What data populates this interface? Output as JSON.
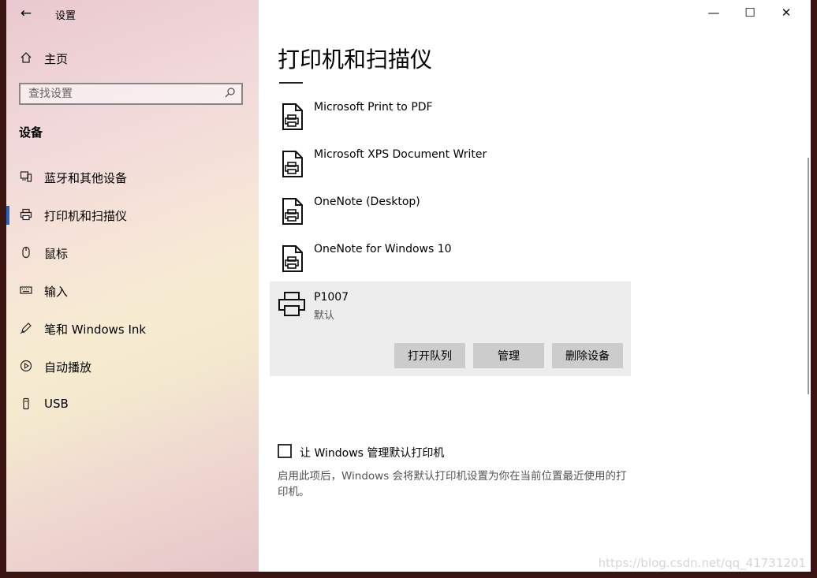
{
  "app": {
    "title": "设置"
  },
  "window_controls": {
    "minimize": "—",
    "maximize": "☐",
    "close": "✕"
  },
  "sidebar": {
    "home_label": "主页",
    "search_placeholder": "查找设置",
    "section_title": "设备",
    "items": [
      {
        "label": "蓝牙和其他设备",
        "icon": "bluetooth-devices-icon"
      },
      {
        "label": "打印机和扫描仪",
        "icon": "printer-icon",
        "active": true
      },
      {
        "label": "鼠标",
        "icon": "mouse-icon"
      },
      {
        "label": "输入",
        "icon": "keyboard-icon"
      },
      {
        "label": "笔和 Windows Ink",
        "icon": "pen-icon"
      },
      {
        "label": "自动播放",
        "icon": "autoplay-icon"
      },
      {
        "label": "USB",
        "icon": "usb-icon"
      }
    ]
  },
  "main": {
    "title": "打印机和扫描仪",
    "printers": [
      {
        "name": "Microsoft Print to PDF"
      },
      {
        "name": "Microsoft XPS Document Writer"
      },
      {
        "name": "OneNote (Desktop)"
      },
      {
        "name": "OneNote for Windows 10"
      },
      {
        "name": "P1007",
        "status": "默认"
      }
    ],
    "buttons": {
      "open_queue": "打开队列",
      "manage": "管理",
      "remove": "删除设备"
    },
    "default_checkbox_label": "让 Windows 管理默认打印机",
    "default_description": "启用此项后，Windows 会将默认打印机设置为你在当前位置最近使用的打印机。"
  },
  "watermark": "https://blog.csdn.net/qq_41731201"
}
